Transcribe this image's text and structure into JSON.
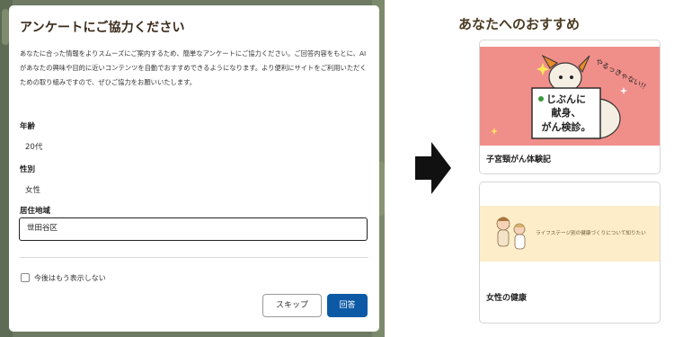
{
  "survey_modal": {
    "title": "アンケートにご協力ください",
    "description": "あなたに合った情報をよりスムーズにご案内するため、簡単なアンケートにご協力ください。ご回答内容をもとに、AIがあなたの興味や目的に近いコンテンツを自動でおすすめできるようになります。より便利にサイトをご利用いただくための取り組みですので、ぜひご協力をお願いいたします。",
    "age": {
      "label": "年齢",
      "value": "20代"
    },
    "gender": {
      "label": "性別",
      "value": "女性"
    },
    "region": {
      "label": "居住地域",
      "value": "世田谷区"
    },
    "dont_show_again": "今後はもう表示しない",
    "skip_button": "スキップ",
    "answer_button": "回答"
  },
  "recommendations": {
    "heading": "あなたへのおすすめ",
    "cards": [
      {
        "title": "子宮頸がん体験記",
        "illustration": {
          "speech_text": "やるっきゃない!!",
          "sign_text": [
            "じぶんに",
            "献身、",
            "がん検診。"
          ]
        }
      },
      {
        "title": "女性の健康",
        "banner_text": "ライフステージ別の健康づくりについて知りたい"
      }
    ]
  },
  "colors": {
    "modal_title": "#3a2a1a",
    "answer_button": "#0c5aa6",
    "card1_bg": "#f08f8a",
    "card2_bg": "#fdeec9",
    "rec_heading": "#4a3a22"
  }
}
